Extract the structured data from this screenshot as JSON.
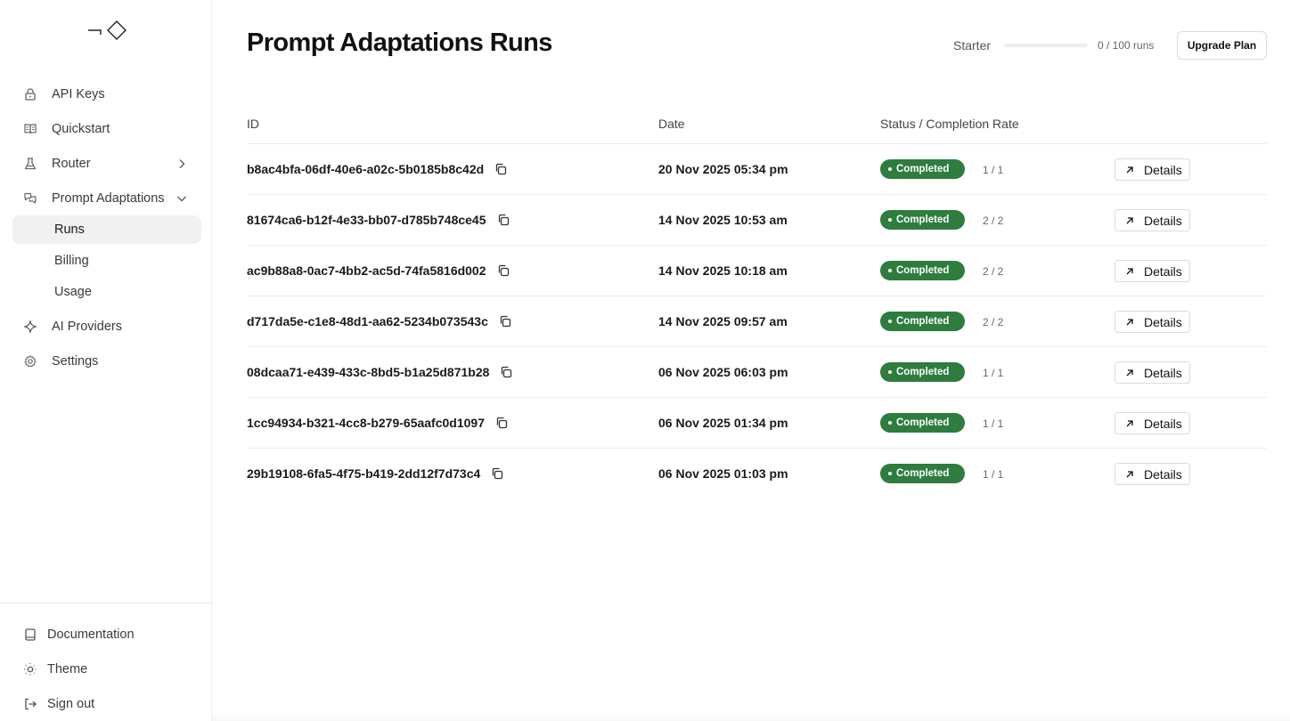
{
  "sidebar": {
    "nav": [
      {
        "label": "API Keys",
        "icon": "lock-icon"
      },
      {
        "label": "Quickstart",
        "icon": "book-open-icon"
      },
      {
        "label": "Router",
        "icon": "flask-icon"
      },
      {
        "label": "Prompt Adaptations",
        "icon": "message-swap-icon"
      }
    ],
    "sub": [
      {
        "label": "Runs",
        "active": true
      },
      {
        "label": "Billing",
        "active": false
      },
      {
        "label": "Usage",
        "active": false
      }
    ],
    "nav2": [
      {
        "label": "AI Providers",
        "icon": "sparkle-icon"
      },
      {
        "label": "Settings",
        "icon": "gear-icon"
      }
    ],
    "footer": [
      {
        "label": "Documentation",
        "icon": "book-icon"
      },
      {
        "label": "Theme",
        "icon": "sun-icon"
      },
      {
        "label": "Sign out",
        "icon": "sign-out-icon"
      }
    ]
  },
  "header": {
    "title": "Prompt Adaptations Runs",
    "plan_label": "Starter",
    "plan_usage_fraction": 0,
    "plan_count": "0 / 100 runs",
    "upgrade_label": "Upgrade Plan"
  },
  "table": {
    "columns": {
      "id": "ID",
      "date": "Date",
      "status": "Status / Completion Rate"
    },
    "rows": [
      {
        "id": "b8ac4bfa-06df-40e6-a02c-5b0185b8c42d",
        "date": "20 Nov 2025 05:34 pm",
        "status": "Completed",
        "rate": "1 / 1",
        "action": "Details"
      },
      {
        "id": "81674ca6-b12f-4e33-bb07-d785b748ce45",
        "date": "14 Nov 2025 10:53 am",
        "status": "Completed",
        "rate": "2 / 2",
        "action": "Details"
      },
      {
        "id": "ac9b88a8-0ac7-4bb2-ac5d-74fa5816d002",
        "date": "14 Nov 2025 10:18 am",
        "status": "Completed",
        "rate": "2 / 2",
        "action": "Details"
      },
      {
        "id": "d717da5e-c1e8-48d1-aa62-5234b073543c",
        "date": "14 Nov 2025 09:57 am",
        "status": "Completed",
        "rate": "2 / 2",
        "action": "Details"
      },
      {
        "id": "08dcaa71-e439-433c-8bd5-b1a25d871b28",
        "date": "06 Nov 2025 06:03 pm",
        "status": "Completed",
        "rate": "1 / 1",
        "action": "Details"
      },
      {
        "id": "1cc94934-b321-4cc8-b279-65aafc0d1097",
        "date": "06 Nov 2025 01:34 pm",
        "status": "Completed",
        "rate": "1 / 1",
        "action": "Details"
      },
      {
        "id": "29b19108-6fa5-4f75-b419-2dd12f7d73c4",
        "date": "06 Nov 2025 01:03 pm",
        "status": "Completed",
        "rate": "1 / 1",
        "action": "Details"
      }
    ]
  },
  "colors": {
    "status_completed": "#2e7d3e",
    "accent": "#2f7a3a"
  }
}
